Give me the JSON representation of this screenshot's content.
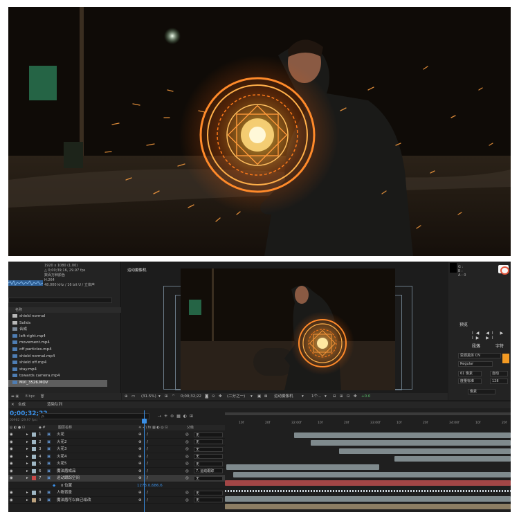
{
  "colors": {
    "accent_blue": "#3a8fe6",
    "track_gray": "#7f8a8d",
    "track_red": "#a34646",
    "track_tan": "#8c7d63",
    "orange_swatch": "#f39a23"
  },
  "project": {
    "info_lines": [
      "1920 x 1080 (1.00)",
      "△ 0;00;39;16, 29.97 fps",
      "数百万种颜色",
      "H.264",
      "48.000 kHz / 16 bit U / 立体声"
    ],
    "name_header": "名称",
    "items": [
      {
        "label": "shield normal",
        "kind": "folder"
      },
      {
        "label": "Solids",
        "kind": "folder"
      },
      {
        "label": "合成",
        "kind": "comp"
      },
      {
        "label": "left-right.mp4",
        "kind": "vid"
      },
      {
        "label": "movement.mp4",
        "kind": "vid"
      },
      {
        "label": "off particles.mp4",
        "kind": "vid"
      },
      {
        "label": "shield normal.mp4",
        "kind": "vid"
      },
      {
        "label": "shield off.mp4",
        "kind": "vid"
      },
      {
        "label": "stay.mp4",
        "kind": "vid"
      },
      {
        "label": "towards camera.mp4",
        "kind": "vid"
      },
      {
        "label": "MVI_3526.MOV",
        "kind": "vid",
        "selected": true
      }
    ],
    "bpc": "8 bpc"
  },
  "viewer": {
    "comp_tab": "运动摄像机",
    "zoom": "(31.5%)",
    "timecode": "0;00;32;22",
    "resolution": "(二分之一)",
    "camera": "运动摄像机",
    "views": "1个...",
    "exposure": "+0.0"
  },
  "right_panel": {
    "color_info": [
      "G :",
      "B :",
      "A : 0"
    ],
    "preview_title": "预览",
    "preview_controls": "I◀ ◀I ▶ I▶ ▶I",
    "paragraph_tab": "段落",
    "character_tab": "字符",
    "font_name": "思源黑体 CN",
    "font_style": "Regular",
    "font_size": "61 像素",
    "auto_label": "自动",
    "kerning_label": "度量标准",
    "tracking_value": "128",
    "pixels_label": "像素"
  },
  "timeline": {
    "tab_comp": "合成",
    "tab_queue": "渲染队列",
    "timecode": "0;00;32;22",
    "fps_line": "00982 (29.97 fps)",
    "search_placeholder": "ρ.",
    "col_layer_name": "图层名称",
    "col_parent": "父级",
    "ruler_ticks": [
      "10f",
      "20f",
      "32:00f",
      "10f",
      "20f",
      "33:00f",
      "10f",
      "20f",
      "34:00f",
      "10f",
      "20f"
    ],
    "layers": [
      {
        "num": "1",
        "name": "火花",
        "color": "#9fb7c4",
        "parent": "无"
      },
      {
        "num": "2",
        "name": "火花2",
        "color": "#9fb7c4",
        "parent": "无"
      },
      {
        "num": "3",
        "name": "火花3",
        "color": "#9fb7c4",
        "parent": "无"
      },
      {
        "num": "4",
        "name": "火花4",
        "color": "#9fb7c4",
        "parent": "无"
      },
      {
        "num": "5",
        "name": "火花5",
        "color": "#9fb7c4",
        "parent": "无"
      },
      {
        "num": "6",
        "name": "魔法盾成品",
        "color": "#9fb7c4",
        "parent": "7. 运动跟踪"
      },
      {
        "num": "7",
        "name": "运动跟踪空间",
        "color": "#c84848",
        "parent": "无",
        "selected": true
      },
      {
        "num": "",
        "name": "ō  位置",
        "color": "",
        "parent": "",
        "value": "1273.0,686.6"
      },
      {
        "num": "8",
        "name": "人物背景",
        "color": "#9fb7c4",
        "parent": "无"
      },
      {
        "num": "9",
        "name": "魔法盾可以自己绘改",
        "color": "#bca27e",
        "parent": "无"
      }
    ]
  }
}
